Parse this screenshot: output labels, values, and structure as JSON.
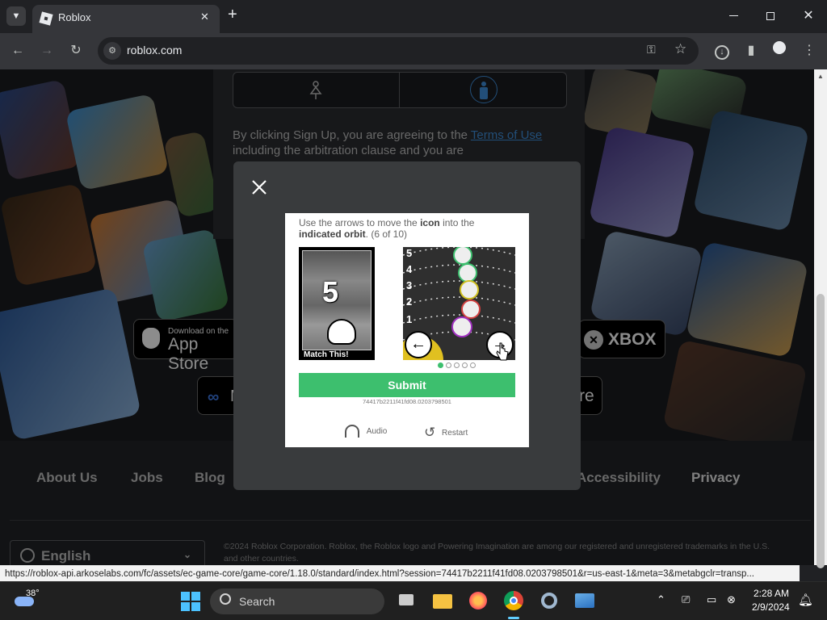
{
  "browser": {
    "tab_title": "Roblox",
    "url": "roblox.com",
    "new_tab_symbol": "+",
    "tab_close_symbol": "✕",
    "status_url": "https://roblox-api.arkoselabs.com/fc/assets/ec-game-core/game-core/1.18.0/standard/index.html?session=74417b2211f41fd08.0203798501&r=us-east-1&meta=3&metabgclr=transp..."
  },
  "signup": {
    "terms_prefix": "By clicking Sign Up, you are agreeing to the ",
    "terms_link": "Terms of Use",
    "terms_suffix": " including the arbitration clause and you are"
  },
  "stores": {
    "app_store_small": "Download on the",
    "app_store_big": "App Store",
    "xbox": "XBOX",
    "other_right": "re",
    "meta_partial": "M"
  },
  "footer": {
    "links": [
      "About Us",
      "Jobs",
      "Blog",
      "Accessibility",
      "Privacy"
    ],
    "language": "English",
    "copyright": "©2024 Roblox Corporation. Roblox, the Roblox logo and Powering Imagination are among our registered and unregistered trademarks in the U.S. and other countries."
  },
  "captcha": {
    "instr_1": "Use the arrows to move the ",
    "instr_icon": "icon",
    "instr_2": " into the ",
    "instr_orbit": "indicated orbit",
    "instr_3": ". (6 of 10)",
    "target_number": "5",
    "match_label": "Match This!",
    "orbit_numbers": [
      "5",
      "4",
      "3",
      "2",
      "1"
    ],
    "submit_label": "Submit",
    "session_id": "74417b2211f41fd08.0203798501",
    "audio_label": "Audio",
    "restart_label": "Restart",
    "page_dots_total": 5,
    "page_dot_active": 1
  },
  "taskbar": {
    "weather_temp": "38°",
    "search_label": "Search",
    "time": "2:28 AM",
    "date": "2/9/2024"
  },
  "colors": {
    "submit_green": "#3dbf6e",
    "link_blue": "#3f8fdb",
    "modal_bg": "#393b3d"
  }
}
